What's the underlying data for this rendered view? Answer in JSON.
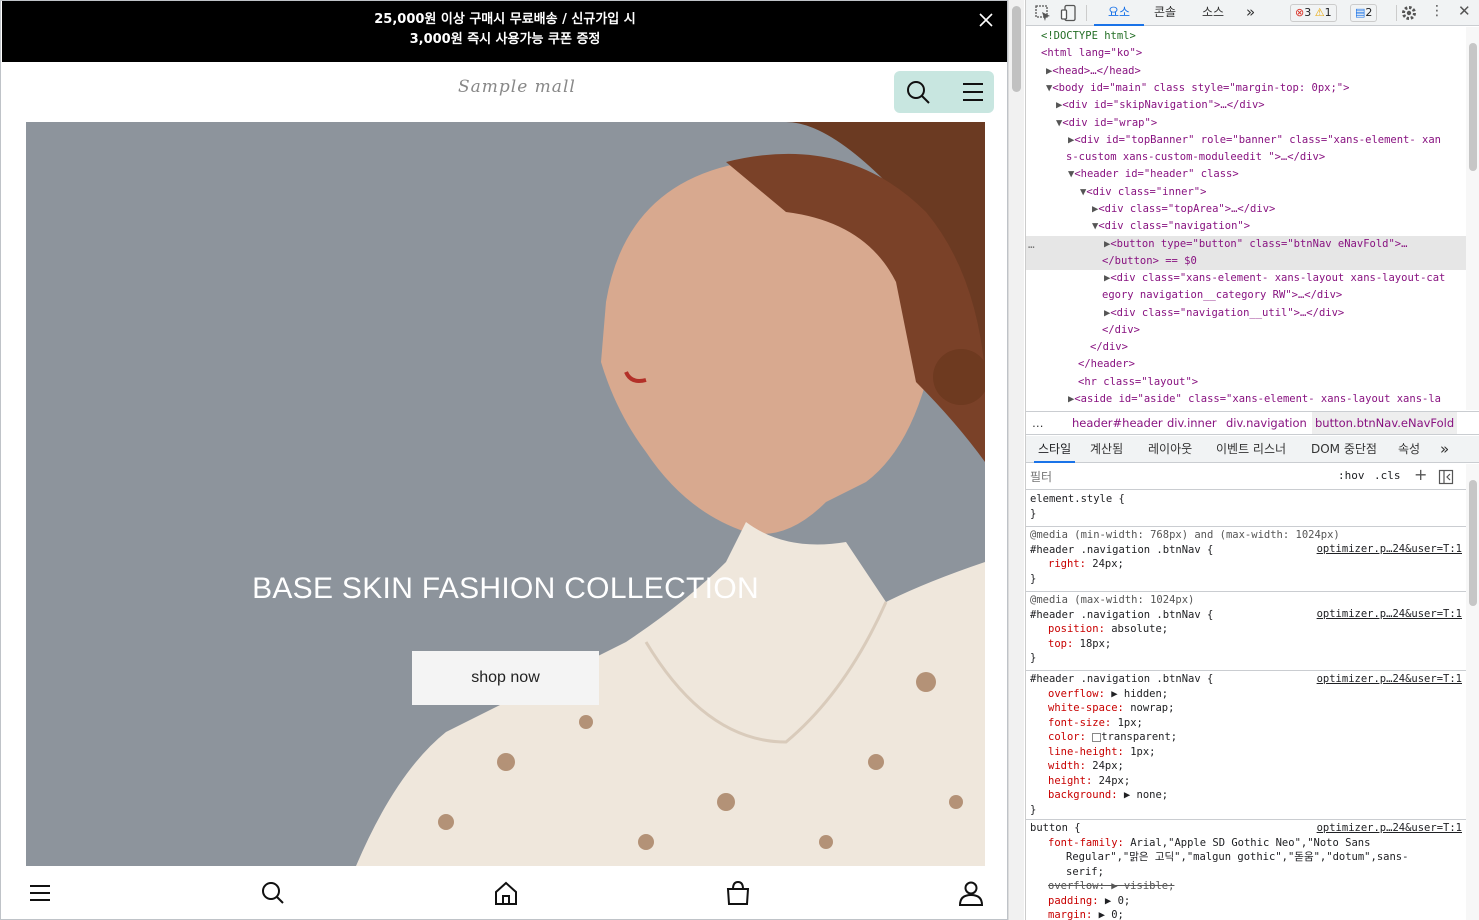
{
  "page": {
    "top_banner": {
      "line1": "25,000원 이상 구매시 무료배송 / 신규가입 시",
      "line2": "3,000원 즉시 사용가능 쿠폰 증정"
    },
    "logo": "Sample mall",
    "hero": {
      "title": "BASE SKIN FASHION COLLECTION",
      "button": "shop now"
    }
  },
  "devtools": {
    "tabs": [
      "요소",
      "콘솔",
      "소스"
    ],
    "badges": {
      "errors": "3",
      "warnings": "1",
      "info": "2"
    },
    "dom": [
      "<!DOCTYPE html>",
      "<html lang=\"ko\">",
      "<head>…</head>",
      "<body id=\"main\" class style=\"margin-top: 0px;\">",
      "<div id=\"skipNavigation\">…</div>",
      "<div id=\"wrap\">",
      "<div id=\"topBanner\" role=\"banner\" class=\"xans-element- xan",
      "s-custom xans-custom-moduleedit \">…</div>",
      "<header id=\"header\" class>",
      "<div class=\"inner\">",
      "<div class=\"topArea\">…</div>",
      "<div class=\"navigation\">",
      "<button type=\"button\" class=\"btnNav eNavFold\">…",
      "</button> == $0",
      "<div class=\"xans-element- xans-layout xans-layout-cat",
      "egory navigation__category RW\">…</div>",
      "<div class=\"navigation__util\">…</div>",
      "</div>",
      "</div>",
      "</header>",
      "<hr class=\"layout\">",
      "<aside id=\"aside\" class=\"xans-element- xans-layout xans-la"
    ],
    "breadcrumbs": [
      "header#header",
      "div.inner",
      "div.navigation",
      "button.btnNav.eNavFold"
    ],
    "pane_tabs": [
      "스타일",
      "계산됨",
      "레이아웃",
      "이벤트 리스너",
      "DOM 중단점",
      "속성"
    ],
    "filter_placeholder": "필터",
    "filter_hov": ":hov",
    "filter_cls": ".cls",
    "styles": {
      "element_style": "element.style {",
      "close": "}",
      "rule1_media": "@media (min-width: 768px) and (max-width: 1024px)",
      "rule1_selector": "#header .navigation .btnNav {",
      "rule1_props": [
        [
          "right",
          "24px;"
        ]
      ],
      "rule2_media": "@media (max-width: 1024px)",
      "rule2_selector": "#header .navigation .btnNav {",
      "rule2_props": [
        [
          "position",
          "absolute;"
        ],
        [
          "top",
          "18px;"
        ]
      ],
      "rule3_selector": "#header .navigation .btnNav {",
      "rule3_props": [
        [
          "overflow",
          "▶ hidden;"
        ],
        [
          "white-space",
          "nowrap;"
        ],
        [
          "font-size",
          "1px;"
        ],
        [
          "color",
          "transparent;"
        ],
        [
          "line-height",
          "1px;"
        ],
        [
          "width",
          "24px;"
        ],
        [
          "height",
          "24px;"
        ],
        [
          "background",
          "▶ none;"
        ]
      ],
      "rule4_selector": "button {",
      "rule4_font_prop": "font-family",
      "rule4_font_val1": "Arial,\"Apple SD Gothic Neo\",\"Noto Sans",
      "rule4_font_val2": "Regular\",\"맑은 고딕\",\"malgun gothic\",\"돋움\",\"dotum\",sans-",
      "rule4_font_val3": "serif;",
      "rule4_overflow": "overflow: ▶ visible;",
      "rule4_padding": [
        "padding",
        "▶ 0;"
      ],
      "rule4_margin": [
        "margin",
        "▶ 0;"
      ],
      "source": "optimizer.p…24&user=T:1"
    }
  }
}
